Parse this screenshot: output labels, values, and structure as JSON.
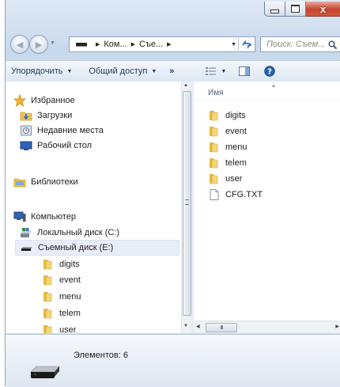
{
  "window": {
    "caption_buttons": {
      "minimize_icon": "minimize-icon",
      "maximize_icon": "maximize-icon",
      "close_glyph": "x"
    }
  },
  "navigation": {
    "back_icon": "back-arrow-icon",
    "forward_icon": "forward-arrow-icon",
    "breadcrumb": [
      "Ком...",
      "Съе..."
    ],
    "refresh_icon": "refresh-icon",
    "search_placeholder": "Поиск: Съем..."
  },
  "toolbar": {
    "organize_label": "Упорядочить",
    "share_label": "Общий доступ",
    "more_label": "»",
    "view_icon": "view-options-icon",
    "preview_icon": "preview-pane-icon",
    "help_icon": "help-icon"
  },
  "nav_pane": {
    "favorites": {
      "label": "Избранное",
      "items": [
        {
          "label": "Загрузки",
          "icon": "downloads-icon"
        },
        {
          "label": "Недавние места",
          "icon": "recent-places-icon"
        },
        {
          "label": "Рабочий стол",
          "icon": "desktop-icon"
        }
      ]
    },
    "libraries": {
      "label": "Библиотеки"
    },
    "computer": {
      "label": "Компьютер",
      "drives": [
        {
          "label": "Локальный диск (C:)",
          "icon": "local-disk-icon"
        },
        {
          "label": "Съемный диск (E:)",
          "icon": "removable-disk-icon",
          "selected": true
        }
      ],
      "folders": [
        "digits",
        "event",
        "menu",
        "telem",
        "user"
      ]
    }
  },
  "files_pane": {
    "column_name": "Имя",
    "items": [
      {
        "name": "digits",
        "type": "folder"
      },
      {
        "name": "event",
        "type": "folder"
      },
      {
        "name": "menu",
        "type": "folder"
      },
      {
        "name": "telem",
        "type": "folder"
      },
      {
        "name": "user",
        "type": "folder"
      },
      {
        "name": "CFG.TXT",
        "type": "file"
      }
    ],
    "hscroll_grip": "III"
  },
  "status_bar": {
    "text": "Элементов: 6",
    "icon": "removable-drive-icon"
  },
  "colors": {
    "accent": "#2f6fc8",
    "folder": "#f0c449",
    "selection": "#e8eef7",
    "toolbar_text": "#1e395b"
  }
}
